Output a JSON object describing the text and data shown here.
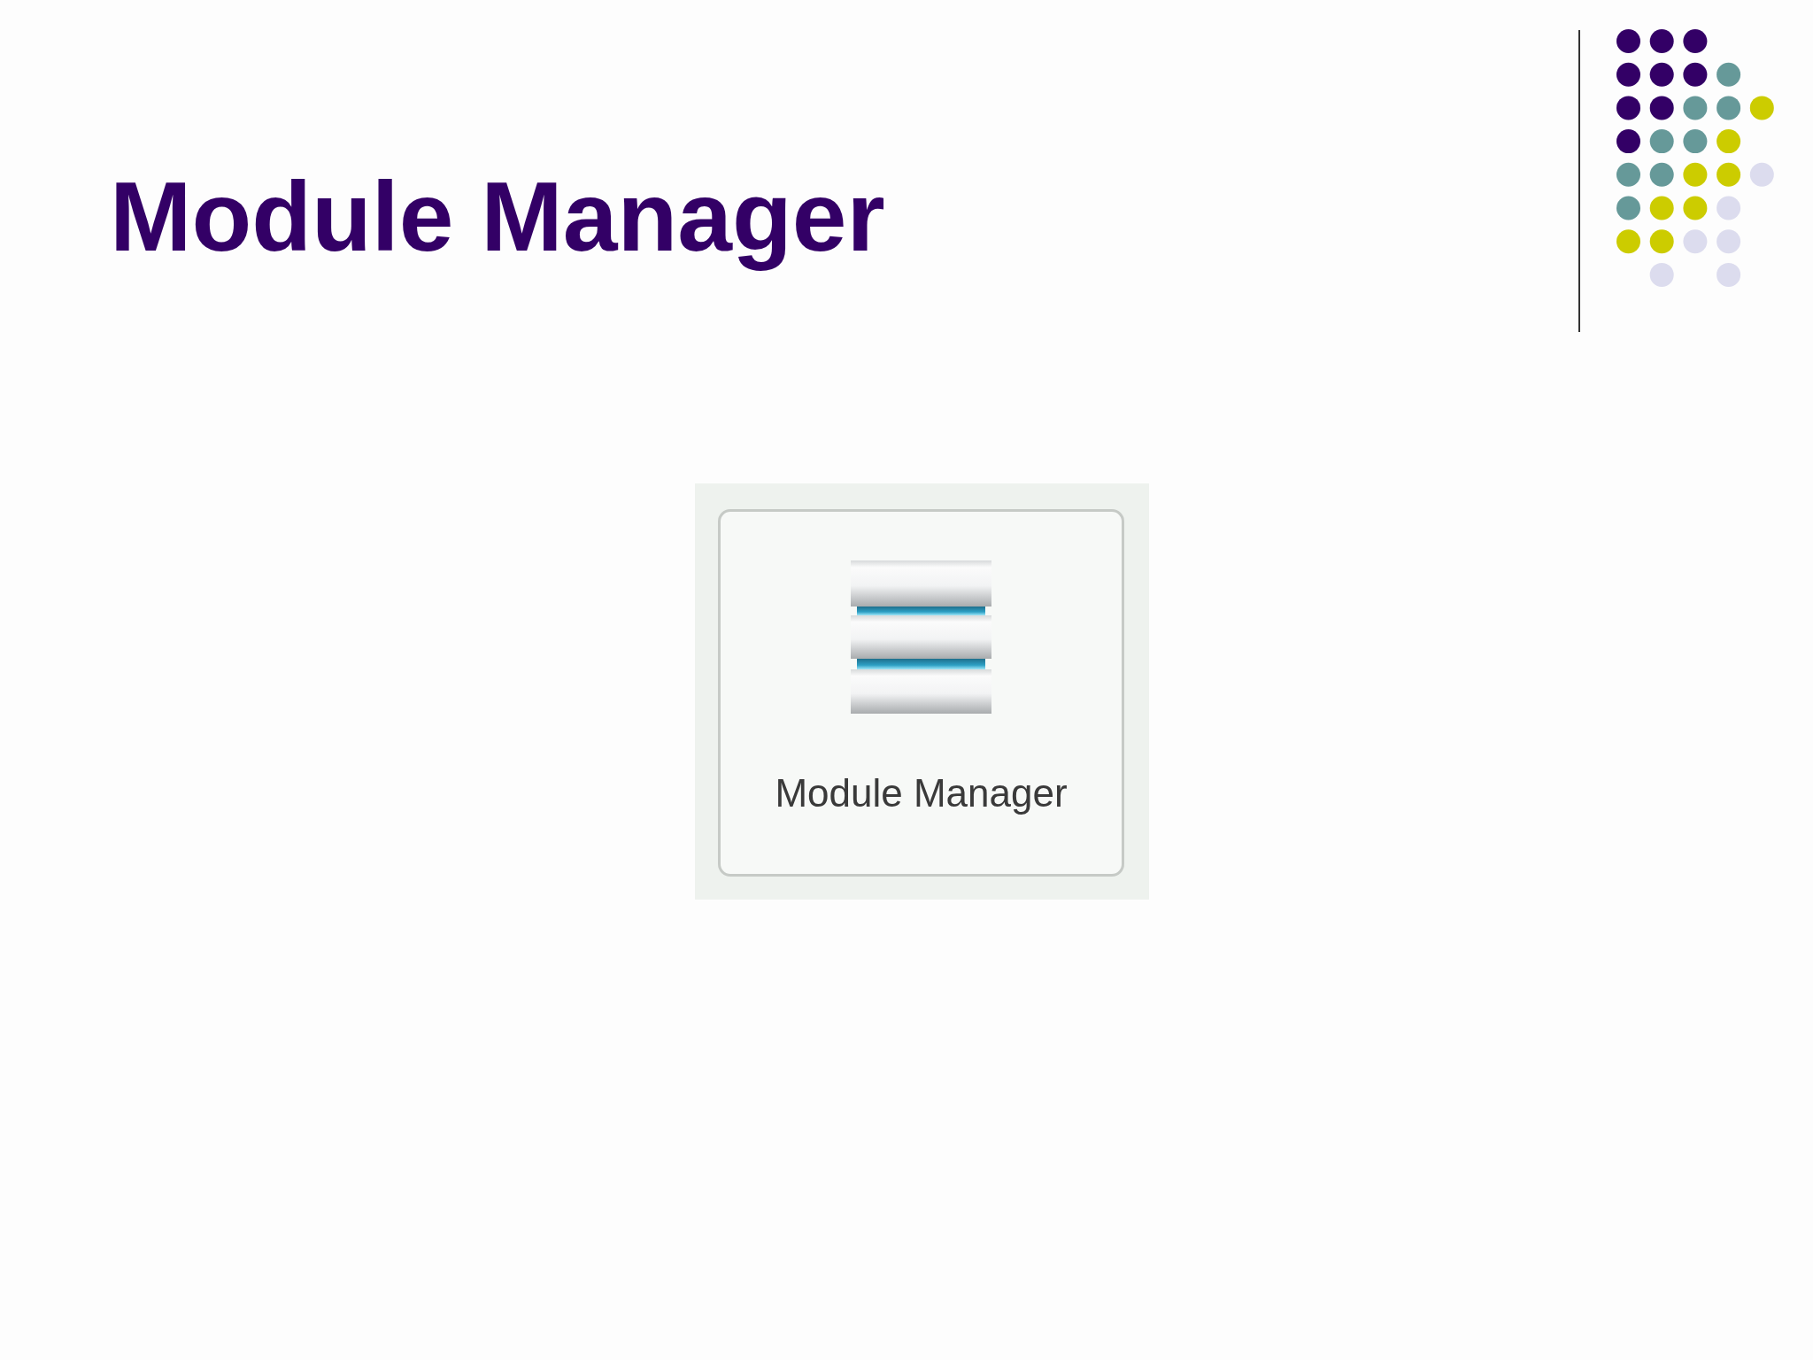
{
  "slide": {
    "title": "Module Manager"
  },
  "screenshot": {
    "button": {
      "label": "Module Manager"
    }
  }
}
